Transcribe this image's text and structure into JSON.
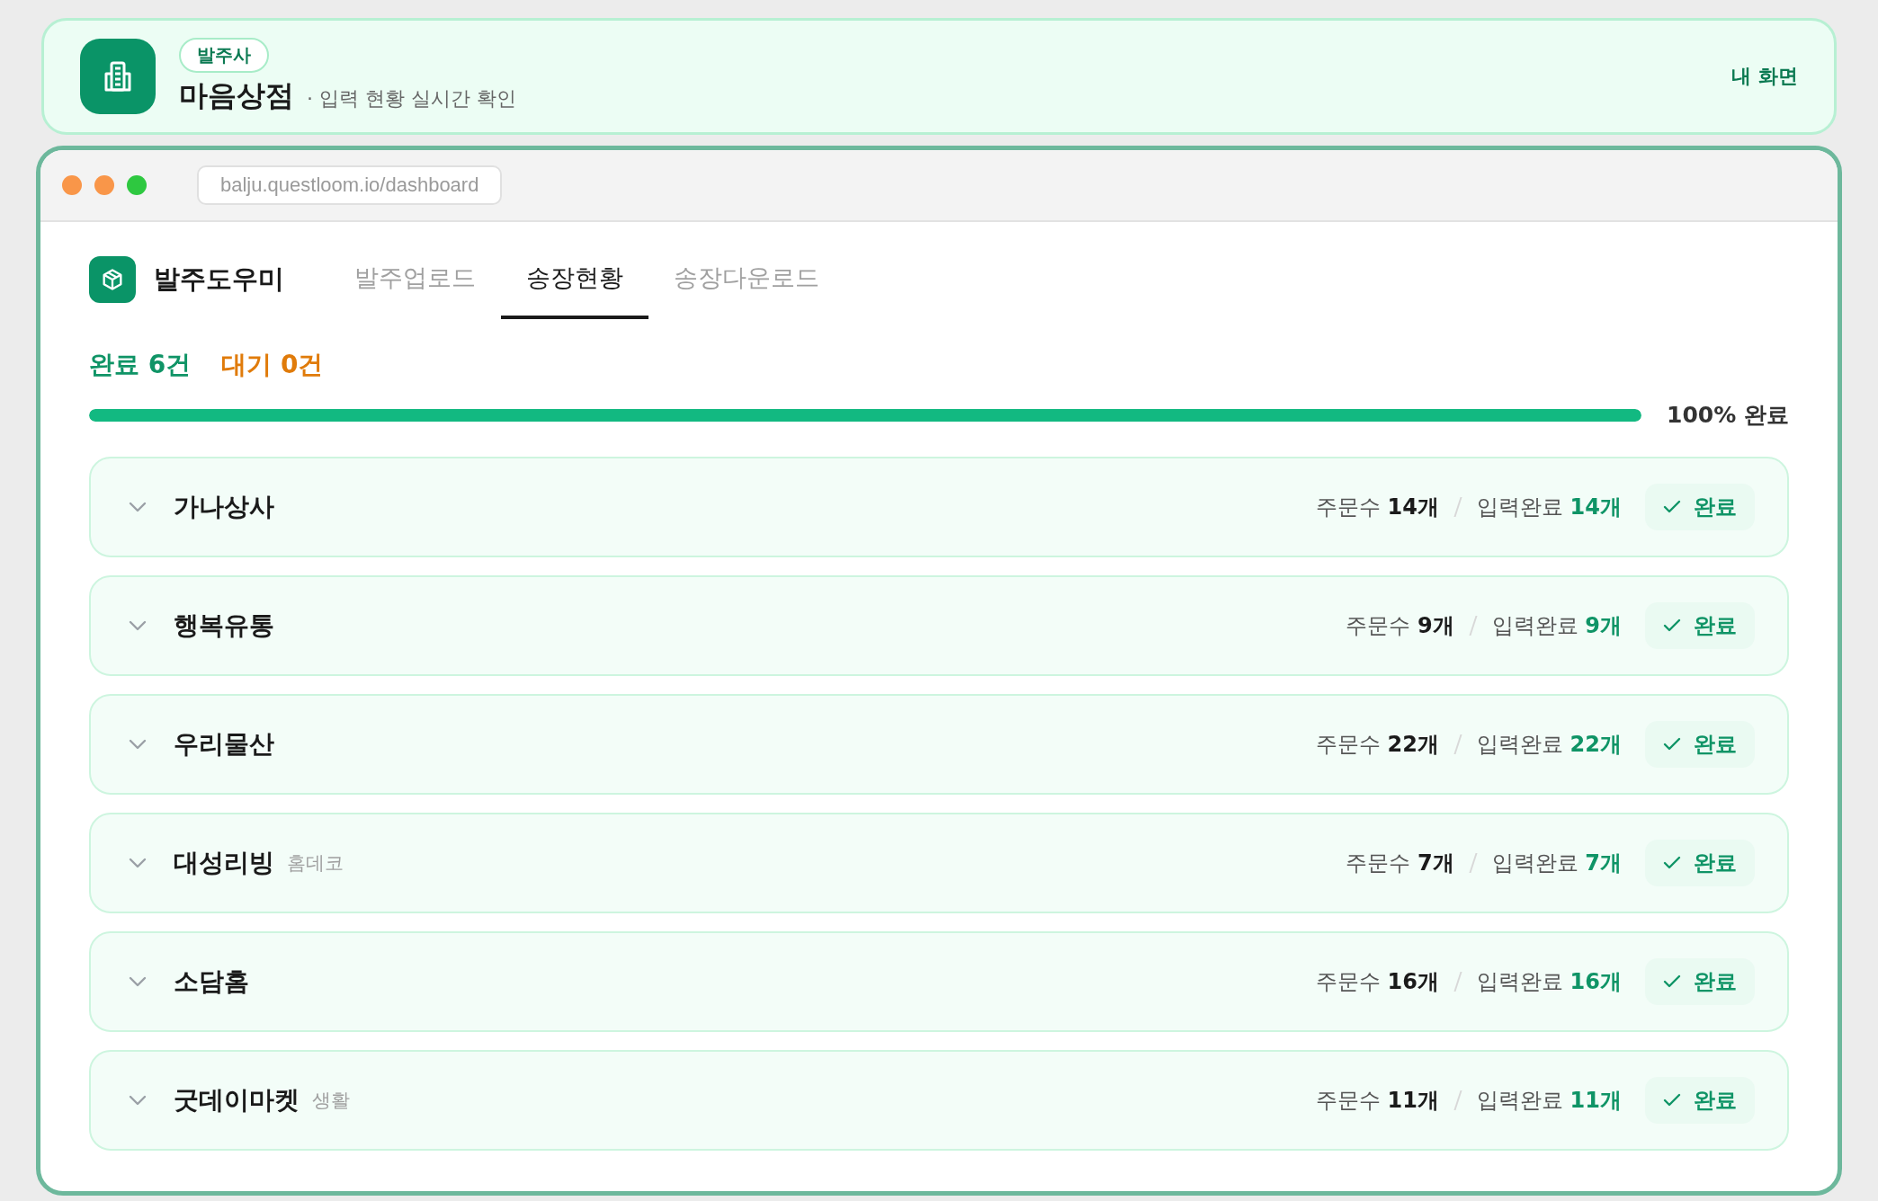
{
  "header": {
    "badge": "발주사",
    "title": "마음상점",
    "subtitle": "· 입력 현황 실시간 확인",
    "link": "내 화면"
  },
  "browser": {
    "url": "balju.questloom.io/dashboard"
  },
  "app": {
    "brand": "발주도우미",
    "tabs": [
      {
        "label": "발주업로드",
        "selected": false
      },
      {
        "label": "송장현황",
        "selected": true
      },
      {
        "label": "송장다운로드",
        "selected": false
      }
    ]
  },
  "summary": [
    {
      "kind": "done",
      "text": "완료 6건"
    },
    {
      "kind": "waiting",
      "text": "대기 0건"
    }
  ],
  "progress": {
    "level": 1,
    "label": "100% 완료"
  },
  "rows": [
    {
      "name": "가나상사",
      "order_label": "주문수",
      "order_count": "14개",
      "done_label": "입력완료",
      "done_count": "14개",
      "status": "완료"
    },
    {
      "name": "행복유통",
      "order_label": "주문수",
      "order_count": "9개",
      "done_label": "입력완료",
      "done_count": "9개",
      "status": "완료"
    },
    {
      "name": "우리물산",
      "order_label": "주문수",
      "order_count": "22개",
      "done_label": "입력완료",
      "done_count": "22개",
      "status": "완료"
    },
    {
      "name": "대성리빙",
      "tag": "홈데코",
      "order_label": "주문수",
      "order_count": "7개",
      "done_label": "입력완료",
      "done_count": "7개",
      "status": "완료"
    },
    {
      "name": "소담홈",
      "order_label": "주문수",
      "order_count": "16개",
      "done_label": "입력완료",
      "done_count": "16개",
      "status": "완료"
    },
    {
      "name": "굿데이마켓",
      "tag": "생활",
      "order_label": "주문수",
      "order_count": "11개",
      "done_label": "입력완료",
      "done_count": "11개",
      "status": "완료"
    }
  ]
}
